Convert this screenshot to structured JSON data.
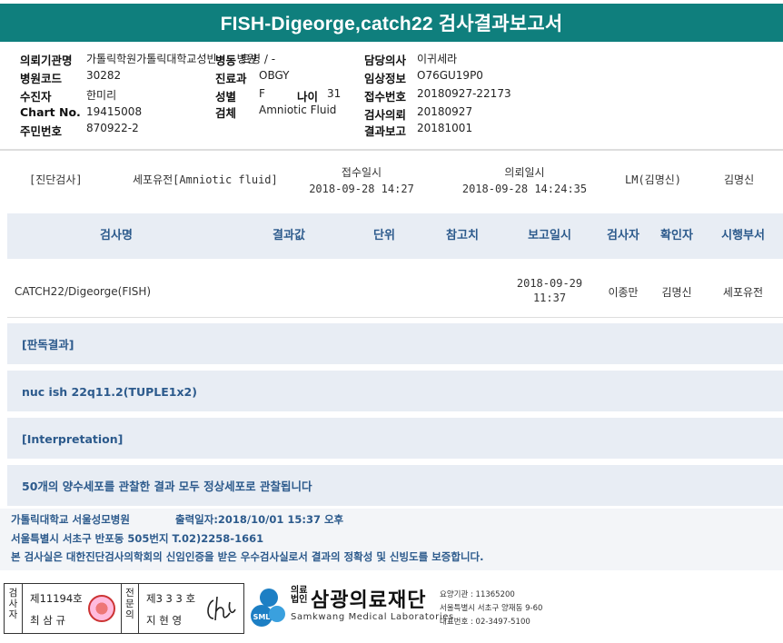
{
  "title": "FISH-Digeorge,catch22 검사결과보고서",
  "patient": {
    "institution_label": "의뢰기관명",
    "institution": "가톨릭학원가톨릭대학교성빈센트병원",
    "ward_label": "병동",
    "ward": "트병 / -",
    "hospital_code_label": "병원코드",
    "hospital_code": "30282",
    "examinee_label": "수진자",
    "examinee": "한미리",
    "chart_label": "Chart No.",
    "chart": "19415008",
    "rrn_label": "주민번호",
    "rrn": "870922-2",
    "dept_label": "진료과",
    "dept": "OBGY",
    "sex_label": "성별",
    "sex": "F",
    "age_label": "나이",
    "age": "31",
    "specimen_label": "검체",
    "specimen": "Amniotic Fluid",
    "doctor_label": "담당의사",
    "doctor": "이귀세라",
    "clinical_label": "임상정보",
    "clinical": "O76GU19P0",
    "receipt_label": "접수번호",
    "receipt": "20180927-22173",
    "request_label": "검사의뢰",
    "request": "20180927",
    "report_label": "결과보고",
    "report": "20181001"
  },
  "summary": {
    "category": "[진단검사]",
    "specimen": "세포유전[Amniotic fluid]",
    "received_label": "접수일시",
    "received": "2018-09-28 14:27",
    "requested_label": "의뢰일시",
    "requested": "2018-09-28 14:24:35",
    "lm": "LM(김명신)",
    "doctor": "김명신"
  },
  "table": {
    "headers": [
      "검사명",
      "결과값",
      "단위",
      "참고치",
      "보고일시",
      "검사자",
      "확인자",
      "시행부서"
    ],
    "row": {
      "test_name": "CATCH22/Digeorge(FISH)",
      "result": "",
      "unit": "",
      "reference": "",
      "report_date": "2018-09-29",
      "report_time": "11:37",
      "tester": "이종만",
      "confirmer": "김명신",
      "department": "세포유전"
    }
  },
  "results": [
    "[판독결과]",
    "nuc ish 22q11.2(TUPLE1x2)",
    "[Interpretation]",
    "50개의 양수세포를 관찰한 결과  모두 정상세포로 관찰됩니다"
  ],
  "footer": {
    "hospital": "가톨릭대학교 서울성모병원",
    "printed": "출력일자:2018/10/01 15:37 오후",
    "address": "서울특별시 서초구 반포동 505번지 T.02)2258-1661",
    "certification": "본 검사실은 대한진단검사의학회의 신임인증을 받은 우수검사실로서 결과의 정확성 및 신빙도를 보증합니다."
  },
  "signatures": {
    "tester_label": "검사자",
    "tester_license": "제11194호",
    "tester_name": "최 삼 규",
    "physician_label": "전문의",
    "physician_license": "제3 3 3 호",
    "physician_name": "지 현 영"
  },
  "lab": {
    "corp_label": "의료법인",
    "name": "삼광의료재단",
    "english": "Samkwang Medical Laboratories",
    "code": "요양기관 : 11365200",
    "address": "서울특별시 서초구 양재동 9-60",
    "phone": "대표번호 : 02-3497-5100",
    "logo_text": "SML"
  },
  "colors": {
    "title_bg": "#0f7f7d",
    "header_bg": "#e8edf4",
    "accent_text": "#2c5a8c"
  }
}
